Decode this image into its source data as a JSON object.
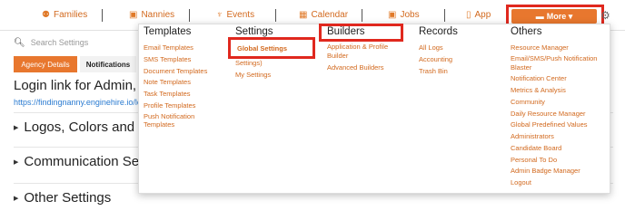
{
  "nav": {
    "families": "Families",
    "nannies": "Nannies",
    "events": "Events",
    "calendar": "Calendar",
    "jobs": "Jobs",
    "app": "App",
    "more": "More ▾"
  },
  "search": {
    "placeholder": "Search Settings"
  },
  "tabs": {
    "agency": "Agency Details",
    "notifications": "Notifications"
  },
  "page": {
    "login_title": "Login link for Admin, Fa",
    "login_link": "https://findingnanny.enginehire.io/lo"
  },
  "sections": {
    "logos": "Logos, Colors and For",
    "communication": "Communication Setti",
    "other": "Other Settings"
  },
  "menu": {
    "templates": {
      "heading": "Templates",
      "items": [
        "Email Templates",
        "SMS Templates",
        "Document Templates",
        "Note Templates",
        "Task Templates",
        "Profile Templates",
        "Push Notification Templates"
      ]
    },
    "settings": {
      "heading": "Settings",
      "global": "Global Settings",
      "partial": "Settings)",
      "my": "My Settings"
    },
    "builders": {
      "heading": "Builders",
      "items": [
        "Application & Profile Builder",
        "Advanced Builders"
      ]
    },
    "records": {
      "heading": "Records",
      "items": [
        "All Logs",
        "Accounting",
        "Trash Bin"
      ]
    },
    "others": {
      "heading": "Others",
      "items": [
        "Resource Manager",
        "Email/SMS/Push Notification Blaster",
        "Notification Center",
        "Metrics & Analysis",
        "Community",
        "Daily Resource Manager",
        "Global Predefined Values",
        "Administrators",
        "Candidate Board",
        "Personal To Do",
        "Admin Badge Manager",
        "Logout"
      ]
    }
  },
  "colors": {
    "accent": "#e8772e",
    "highlight": "#e0281e",
    "link": "#2a7bd1"
  }
}
